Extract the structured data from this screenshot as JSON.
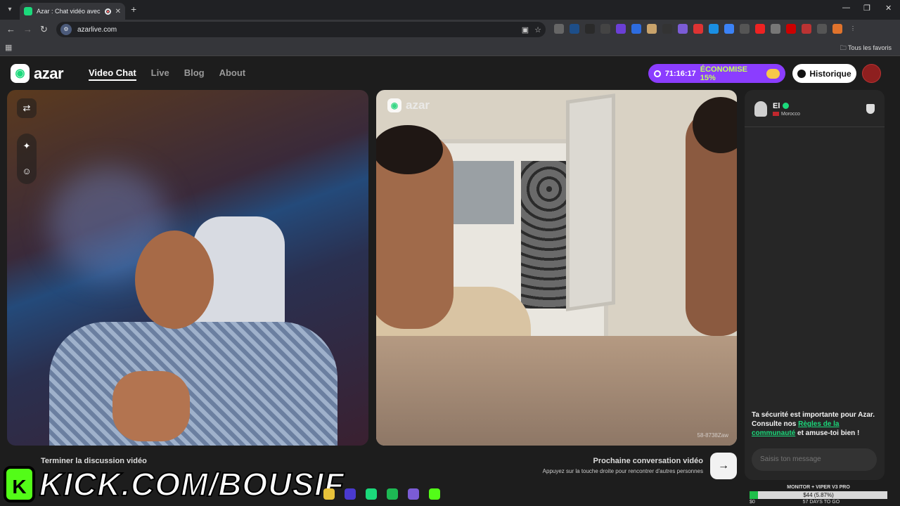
{
  "browser": {
    "tab_title": "Azar : Chat vidéo avec de n",
    "url": "azarlive.com",
    "bookmarks_folder": "Tous les favoris"
  },
  "header": {
    "logo_text": "azar",
    "nav": [
      {
        "label": "Video Chat",
        "active": true
      },
      {
        "label": "Live",
        "active": false
      },
      {
        "label": "Blog",
        "active": false
      },
      {
        "label": "About",
        "active": false
      }
    ],
    "promo_timer": "71:16:17",
    "promo_text": "ÉCONOMISE 15%",
    "history_label": "Historique"
  },
  "remote": {
    "watermark": "azar",
    "session_code": "58-8738Zaw"
  },
  "side": {
    "peer_name": "El",
    "peer_country": "Morocco",
    "safety_text_1": "Ta sécurité est importante pour Azar. Consulte nos ",
    "safety_link": "Règles de la communauté",
    "safety_text_2": " et amuse-toi bien !",
    "message_placeholder": "Saisis ton message"
  },
  "footer": {
    "end_call": "Terminer la discussion vidéo",
    "next_title": "Prochaine conversation vidéo",
    "next_sub": "Appuyez sur la touche droite pour rencontrer d'autres personnes"
  },
  "overlay": {
    "kick_url": "KICK.COM/BOUSIF",
    "goal_label": "MONITOR + VIPER V3 PRO",
    "goal_value": "$44 (5.87%)",
    "goal_fraction": 0.0587,
    "goal_start": "$0",
    "goal_days": "57 DAYS TO GO"
  },
  "colors": {
    "accent": "#1bd97b",
    "promo": "#8b3dff",
    "kick": "#53fc18"
  }
}
